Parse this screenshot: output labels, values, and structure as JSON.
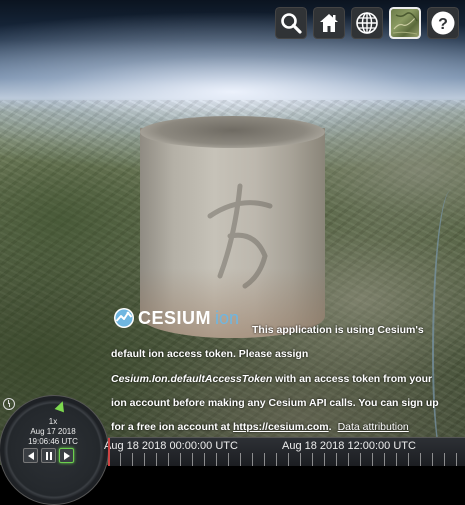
{
  "toolbar": {
    "buttons": [
      {
        "icon": "search-icon",
        "tooltip": "Geocoder"
      },
      {
        "icon": "home-icon",
        "tooltip": "View Home"
      },
      {
        "icon": "globe-icon",
        "tooltip": "Scene mode"
      },
      {
        "icon": "imagery-layer-icon",
        "tooltip": "Base layer picker"
      },
      {
        "icon": "help-icon",
        "tooltip": "Navigation instructions"
      }
    ]
  },
  "branding": {
    "logo_text": "CESIUM",
    "logo_suffix": "ion"
  },
  "token_message": {
    "line1": "This application is using Cesium's",
    "line2": "default ion access token. Please assign",
    "line3_em": "Cesium.Ion.defaultAccessToken",
    "line3_rest": " with an access token from your",
    "line4": "ion account before making any Cesium API calls. You can sign up",
    "line5_pre": "for a free ion account at ",
    "link": "https://cesium.com",
    "line5_post": ".",
    "attribution": "Data attribution"
  },
  "animation": {
    "speed": "1x",
    "date": "Aug 17 2018",
    "time": "19:06:46 UTC"
  },
  "timeline": {
    "labels": [
      "Aug 18 2018 00:00:00 UTC",
      "Aug 18 2018 12:00:00 UTC"
    ]
  },
  "colors": {
    "toolbar_bg": "#303336",
    "accent_green": "#6ccf4e",
    "ion_blue": "#6fb6e0"
  }
}
